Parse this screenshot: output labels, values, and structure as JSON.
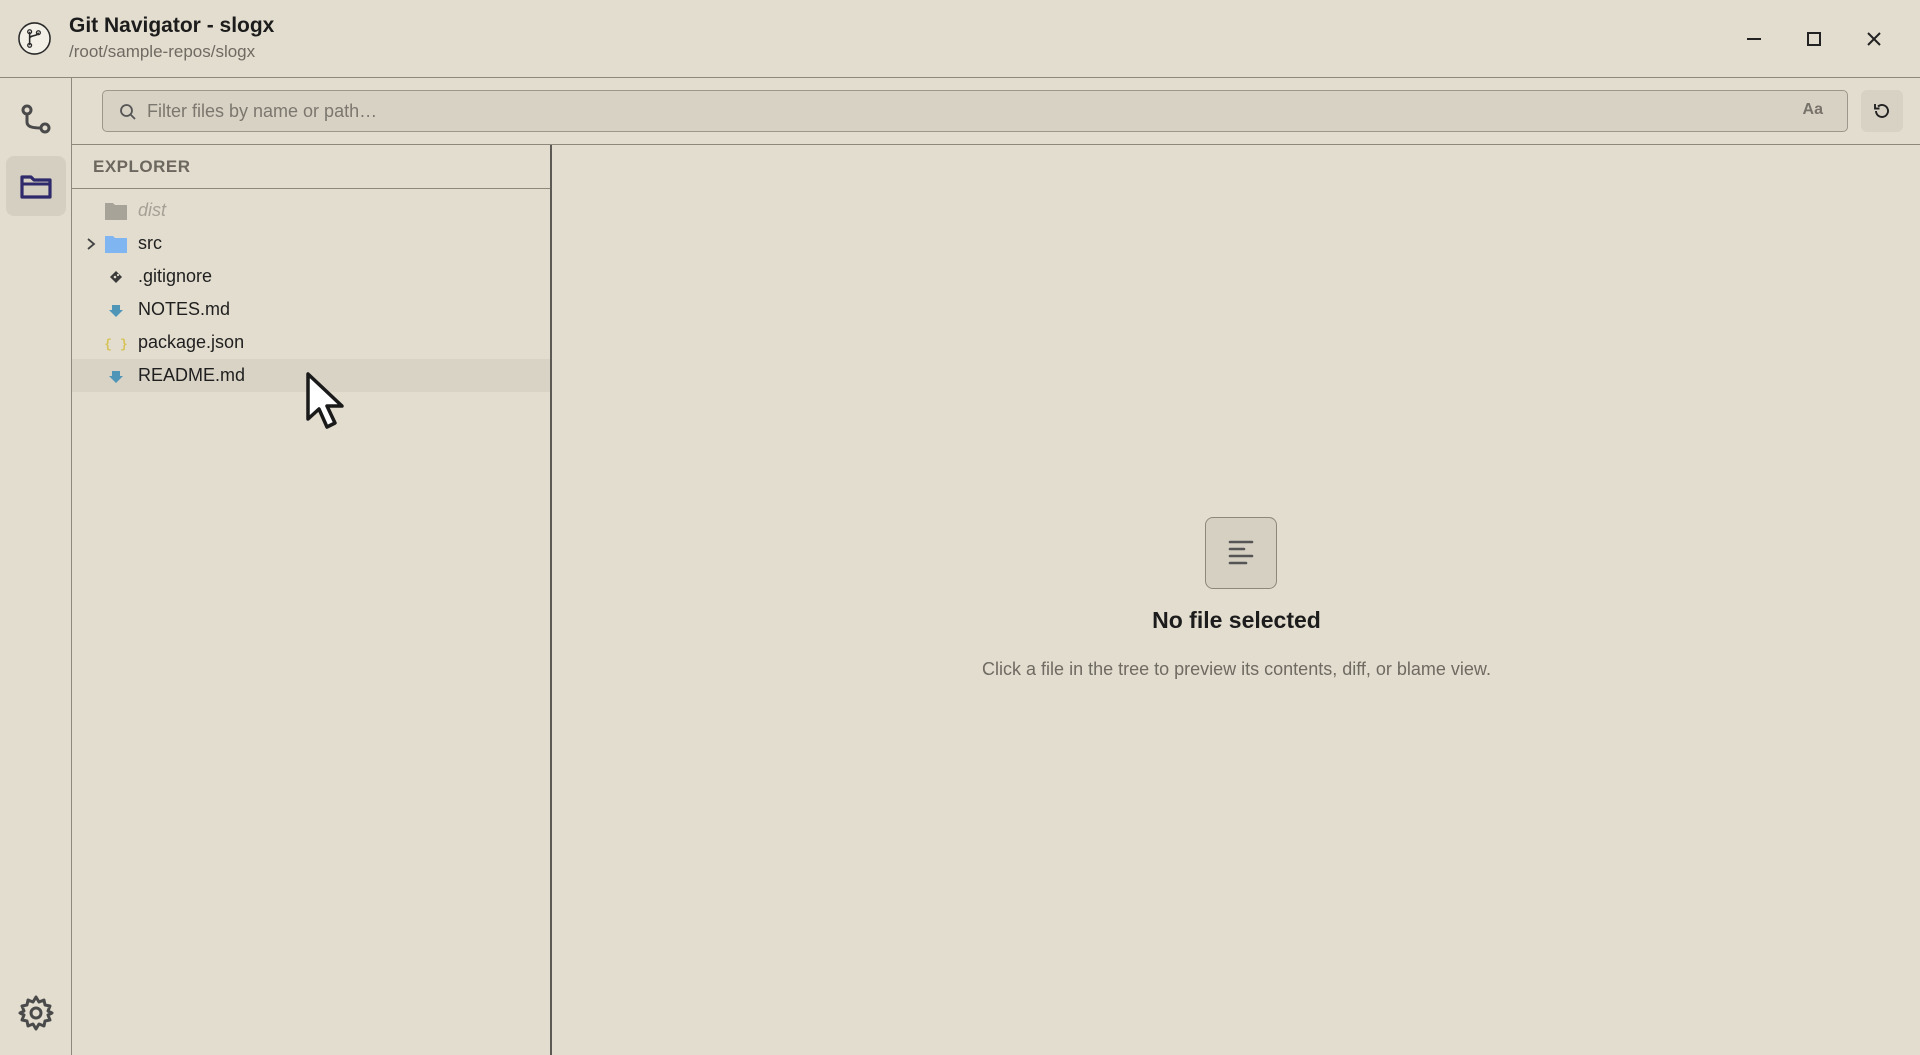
{
  "window": {
    "title": "Git Navigator - slogx",
    "subtitle": "/root/sample-repos/slogx"
  },
  "search": {
    "placeholder": "Filter files by name or path…",
    "value": "",
    "case_toggle_label": "Aa"
  },
  "explorer": {
    "header": "EXPLORER",
    "items": [
      {
        "label": "dist",
        "type": "folder",
        "dimmed": true,
        "icon": "folder-icon"
      },
      {
        "label": "src",
        "type": "folder",
        "expandable": true,
        "icon": "folder-icon"
      },
      {
        "label": ".gitignore",
        "type": "file",
        "icon": "git-icon"
      },
      {
        "label": "NOTES.md",
        "type": "file",
        "icon": "markdown-icon"
      },
      {
        "label": "package.json",
        "type": "file",
        "icon": "json-icon"
      },
      {
        "label": "README.md",
        "type": "file",
        "icon": "markdown-icon",
        "hovered": true
      }
    ]
  },
  "empty_state": {
    "title": "No file selected",
    "subtitle": "Click a file in the tree to preview its contents, diff, or blame view."
  },
  "colors": {
    "background": "#e3ddcf",
    "folder_blue": "#7fb5f0",
    "folder_gray": "#a8a398",
    "markdown_blue": "#4e95b8",
    "json_yellow": "#d6c35a",
    "active_icon": "#2f2a6b"
  }
}
